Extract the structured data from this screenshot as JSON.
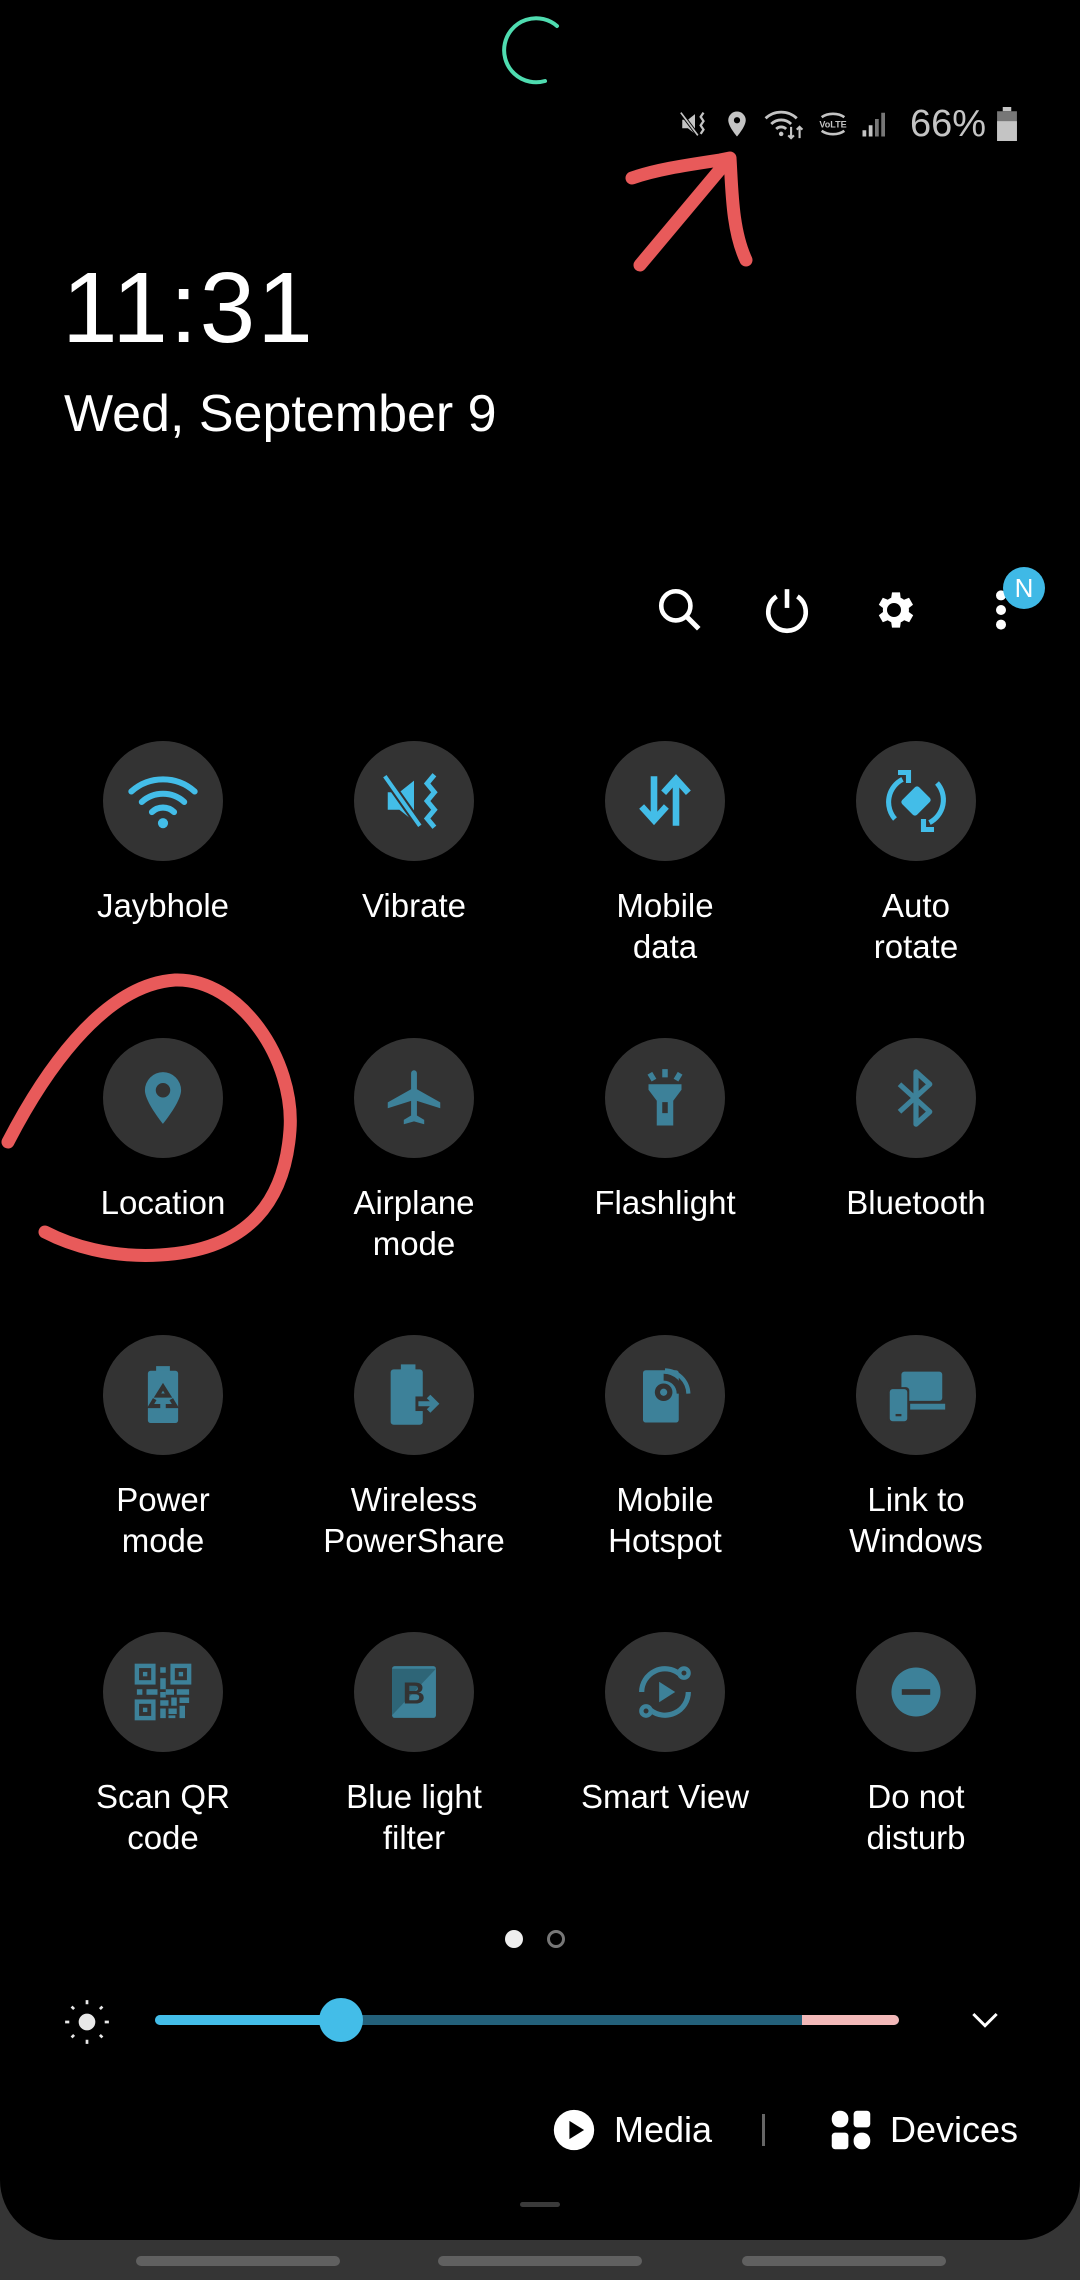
{
  "status_bar": {
    "icons": [
      "vibrate-mute-icon",
      "location-icon",
      "wifi-data-icon",
      "volte-icon",
      "signal-icon",
      "battery-icon"
    ],
    "volte_label": "VoLTE",
    "battery_percent": "66%"
  },
  "header": {
    "time": "11:31",
    "date": "Wed, September 9"
  },
  "quick_actions": {
    "search": "search-icon",
    "power": "power-icon",
    "settings": "gear-icon",
    "more": "more-vert-icon",
    "notification_badge": "N"
  },
  "tiles": [
    {
      "label": "Jaybhole",
      "icon": "wifi-icon",
      "active": true
    },
    {
      "label": "Vibrate",
      "icon": "vibrate-icon",
      "active": true
    },
    {
      "label": "Mobile\ndata",
      "icon": "mobile-data-icon",
      "active": true
    },
    {
      "label": "Auto\nrotate",
      "icon": "auto-rotate-icon",
      "active": true
    },
    {
      "label": "Location",
      "icon": "location-icon",
      "active": false
    },
    {
      "label": "Airplane\nmode",
      "icon": "airplane-icon",
      "active": false
    },
    {
      "label": "Flashlight",
      "icon": "flashlight-icon",
      "active": false
    },
    {
      "label": "Bluetooth",
      "icon": "bluetooth-icon",
      "active": false
    },
    {
      "label": "Power\nmode",
      "icon": "power-mode-icon",
      "active": false
    },
    {
      "label": "Wireless\nPowerShare",
      "icon": "wireless-powershare-icon",
      "active": false
    },
    {
      "label": "Mobile\nHotspot",
      "icon": "hotspot-icon",
      "active": false
    },
    {
      "label": "Link to\nWindows",
      "icon": "link-to-windows-icon",
      "active": false
    },
    {
      "label": "Scan QR\ncode",
      "icon": "qr-code-icon",
      "active": false
    },
    {
      "label": "Blue light\nfilter",
      "icon": "blue-light-filter-icon",
      "active": false
    },
    {
      "label": "Smart View",
      "icon": "smart-view-icon",
      "active": false
    },
    {
      "label": "Do not\ndisturb",
      "icon": "do-not-disturb-icon",
      "active": false
    }
  ],
  "pager": {
    "current_page": 1,
    "total_pages": 2
  },
  "brightness": {
    "level_percent": 25,
    "high_zone_start_percent": 87
  },
  "bottom": {
    "media_label": "Media",
    "devices_label": "Devices"
  },
  "colors": {
    "active_icon": "#43bde8",
    "inactive_icon": "#3d8199",
    "tile_bg": "#333333",
    "accent_spinner": "#4fdcb0",
    "annotation": "#e85a5a"
  }
}
